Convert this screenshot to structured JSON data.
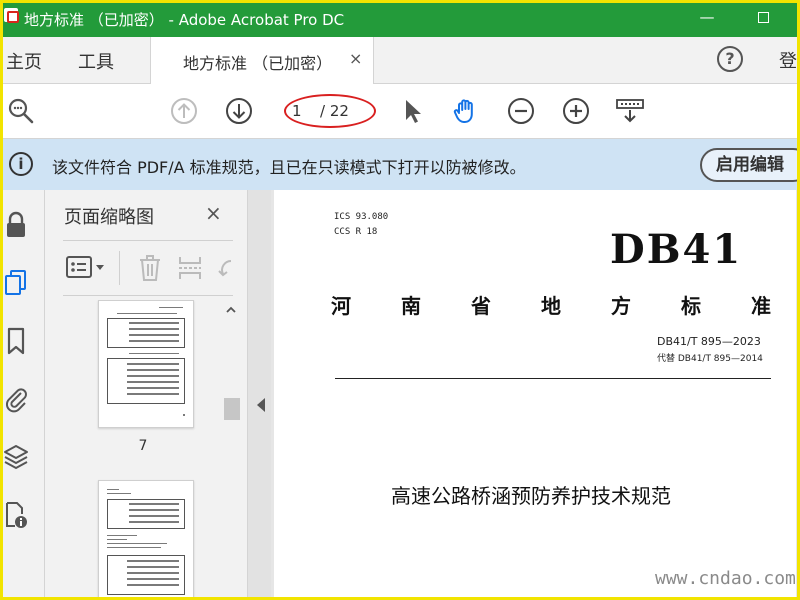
{
  "window": {
    "title": "地方标准 （已加密） - Adobe Acrobat Pro DC",
    "minimize_glyph": "—"
  },
  "menu": {
    "home": "主页",
    "tools": "工具",
    "doc_tab": "地方标准 （已加密）",
    "tab_close": "×",
    "help_glyph": "?",
    "login": "登"
  },
  "toolbar": {
    "page_current": "1",
    "page_total": "/ 22"
  },
  "infobar": {
    "icon_glyph": "i",
    "message": "该文件符合 PDF/A 标准规范，且已在只读模式下打开以防被修改。",
    "edit_button": "启用编辑"
  },
  "thumbnails": {
    "title": "页面缩略图",
    "close": "×",
    "pages": [
      {
        "label": "7"
      },
      {
        "label": ""
      }
    ]
  },
  "document": {
    "ics": "ICS  93.080",
    "ccs": "CCS  R 18",
    "db_code": "DB41",
    "province_chars": [
      "河",
      "南",
      "省",
      "地",
      "方",
      "标",
      "准"
    ],
    "standard_no": "DB41/T 895—2023",
    "replaces": "代替 DB41/T 895—2014",
    "title": "高速公路桥涵预防养护技术规范",
    "watermark": "www.cndao.com"
  },
  "colors": {
    "titlebar": "#239b3a",
    "infobar": "#cfe3f4",
    "annotation_ellipse": "#d92020",
    "frame": "#f2e400",
    "active_blue": "#1473e6"
  }
}
